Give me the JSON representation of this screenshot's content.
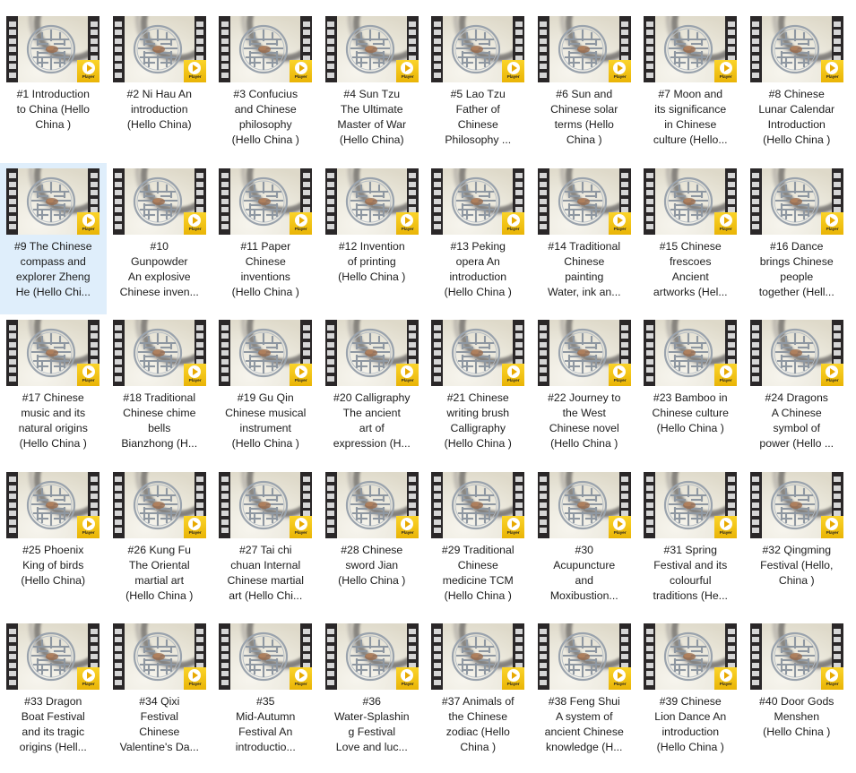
{
  "app": {
    "view": "video-thumbnail-grid",
    "columns": 8,
    "rows": 5,
    "selection_color": "#dfeefb",
    "badge_color": "#f5c518",
    "background_color": "#ffffff",
    "text_color": "#1c1c1c"
  },
  "badge": {
    "label": "Player",
    "icon": "play-triangle-icon"
  },
  "thumbnail": {
    "icon": "film-strip-icon",
    "subject": "chinese-longevity-medallion"
  },
  "items": [
    {
      "index": 1,
      "caption": "#1 Introduction\nto China (Hello\nChina )",
      "selected": false
    },
    {
      "index": 2,
      "caption": "#2 Ni Hau   An\nintroduction\n(Hello China)",
      "selected": false
    },
    {
      "index": 3,
      "caption": "#3 Confucius\nand Chinese\nphilosophy\n(Hello China )",
      "selected": false
    },
    {
      "index": 4,
      "caption": "#4 Sun Tzu\nThe Ultimate\nMaster of War\n(Hello China)",
      "selected": false
    },
    {
      "index": 5,
      "caption": "#5 Lao Tzu\nFather of\nChinese\nPhilosophy ...",
      "selected": false
    },
    {
      "index": 6,
      "caption": "#6 Sun and\nChinese solar\nterms (Hello\nChina )",
      "selected": false
    },
    {
      "index": 7,
      "caption": "#7 Moon and\nits significance\nin Chinese\nculture (Hello...",
      "selected": false
    },
    {
      "index": 8,
      "caption": "#8 Chinese\nLunar Calendar\nIntroduction\n(Hello China )",
      "selected": false
    },
    {
      "index": 9,
      "caption": "#9 The Chinese\ncompass and\nexplorer Zheng\nHe (Hello Chi...",
      "selected": true
    },
    {
      "index": 10,
      "caption": "#10\nGunpowder\nAn explosive\nChinese inven...",
      "selected": false
    },
    {
      "index": 11,
      "caption": "#11 Paper\nChinese\ninventions\n(Hello China )",
      "selected": false
    },
    {
      "index": 12,
      "caption": "#12 Invention\nof printing\n(Hello China )",
      "selected": false
    },
    {
      "index": 13,
      "caption": "#13 Peking\nopera   An\nintroduction\n(Hello China )",
      "selected": false
    },
    {
      "index": 14,
      "caption": "#14 Traditional\nChinese\npainting\nWater, ink an...",
      "selected": false
    },
    {
      "index": 15,
      "caption": "#15 Chinese\nfrescoes\nAncient\nartworks (Hel...",
      "selected": false
    },
    {
      "index": 16,
      "caption": "#16 Dance\nbrings Chinese\npeople\ntogether (Hell...",
      "selected": false
    },
    {
      "index": 17,
      "caption": "#17 Chinese\nmusic and its\nnatural origins\n(Hello China )",
      "selected": false
    },
    {
      "index": 18,
      "caption": "#18 Traditional\nChinese chime\nbells\nBianzhong (H...",
      "selected": false
    },
    {
      "index": 19,
      "caption": "#19 Gu Qin\nChinese musical\ninstrument\n(Hello China )",
      "selected": false
    },
    {
      "index": 20,
      "caption": "#20 Calligraphy\nThe ancient\nart of\nexpression (H...",
      "selected": false
    },
    {
      "index": 21,
      "caption": "#21 Chinese\nwriting brush\nCalligraphy\n(Hello China )",
      "selected": false
    },
    {
      "index": 22,
      "caption": "#22 Journey to\nthe West\nChinese novel\n(Hello China )",
      "selected": false
    },
    {
      "index": 23,
      "caption": "#23 Bamboo in\nChinese culture\n(Hello China )",
      "selected": false
    },
    {
      "index": 24,
      "caption": "#24 Dragons\nA Chinese\nsymbol of\npower (Hello ...",
      "selected": false
    },
    {
      "index": 25,
      "caption": "#25 Phoenix\nKing of birds\n(Hello China)",
      "selected": false
    },
    {
      "index": 26,
      "caption": "#26 Kung Fu\nThe Oriental\nmartial art\n(Hello China )",
      "selected": false
    },
    {
      "index": 27,
      "caption": "#27 Tai chi\nchuan   Internal\nChinese martial\nart (Hello Chi...",
      "selected": false
    },
    {
      "index": 28,
      "caption": "#28 Chinese\nsword   Jian\n(Hello China )",
      "selected": false
    },
    {
      "index": 29,
      "caption": "#29 Traditional\nChinese\nmedicine   TCM\n(Hello China )",
      "selected": false
    },
    {
      "index": 30,
      "caption": "#30\nAcupuncture\nand\nMoxibustion...",
      "selected": false
    },
    {
      "index": 31,
      "caption": "#31 Spring\nFestival and its\ncolourful\ntraditions (He...",
      "selected": false
    },
    {
      "index": 32,
      "caption": "#32 Qingming\nFestival (Hello,\nChina )",
      "selected": false
    },
    {
      "index": 33,
      "caption": "#33 Dragon\nBoat Festival\nand its tragic\norigins (Hell...",
      "selected": false
    },
    {
      "index": 34,
      "caption": "#34 Qixi\nFestival\nChinese\nValentine's Da...",
      "selected": false
    },
    {
      "index": 35,
      "caption": "#35\nMid-Autumn\nFestival   An\nintroductio...",
      "selected": false
    },
    {
      "index": 36,
      "caption": "#36\nWater-Splashin\ng Festival\nLove and luc...",
      "selected": false
    },
    {
      "index": 37,
      "caption": "#37 Animals of\nthe Chinese\nzodiac (Hello\nChina )",
      "selected": false
    },
    {
      "index": 38,
      "caption": "#38 Feng Shui\nA system of\nancient Chinese\nknowledge (H...",
      "selected": false
    },
    {
      "index": 39,
      "caption": "#39 Chinese\nLion Dance   An\nintroduction\n(Hello China )",
      "selected": false
    },
    {
      "index": 40,
      "caption": "#40 Door Gods\nMenshen\n(Hello China )",
      "selected": false
    }
  ]
}
